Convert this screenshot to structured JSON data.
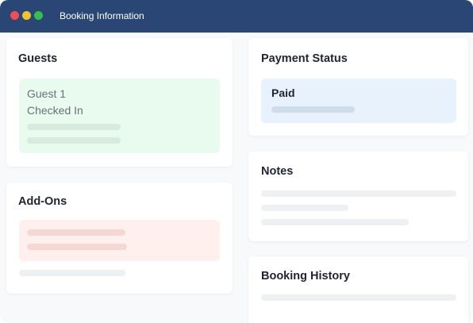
{
  "window": {
    "title": "Booking Information",
    "controls": [
      "close",
      "minimize",
      "maximize"
    ]
  },
  "guests": {
    "title": "Guests",
    "guest_name": "Guest 1",
    "guest_status": "Checked In"
  },
  "add_ons": {
    "title": "Add-Ons"
  },
  "payment": {
    "title": "Payment Status",
    "status": "Paid"
  },
  "notes": {
    "title": "Notes"
  },
  "history": {
    "title": "Booking History"
  },
  "colors": {
    "titlebar": "#2a4674",
    "guest_panel": "#e9fbef",
    "addon_panel": "#fff0ee",
    "payment_panel": "#e8f2fd"
  }
}
